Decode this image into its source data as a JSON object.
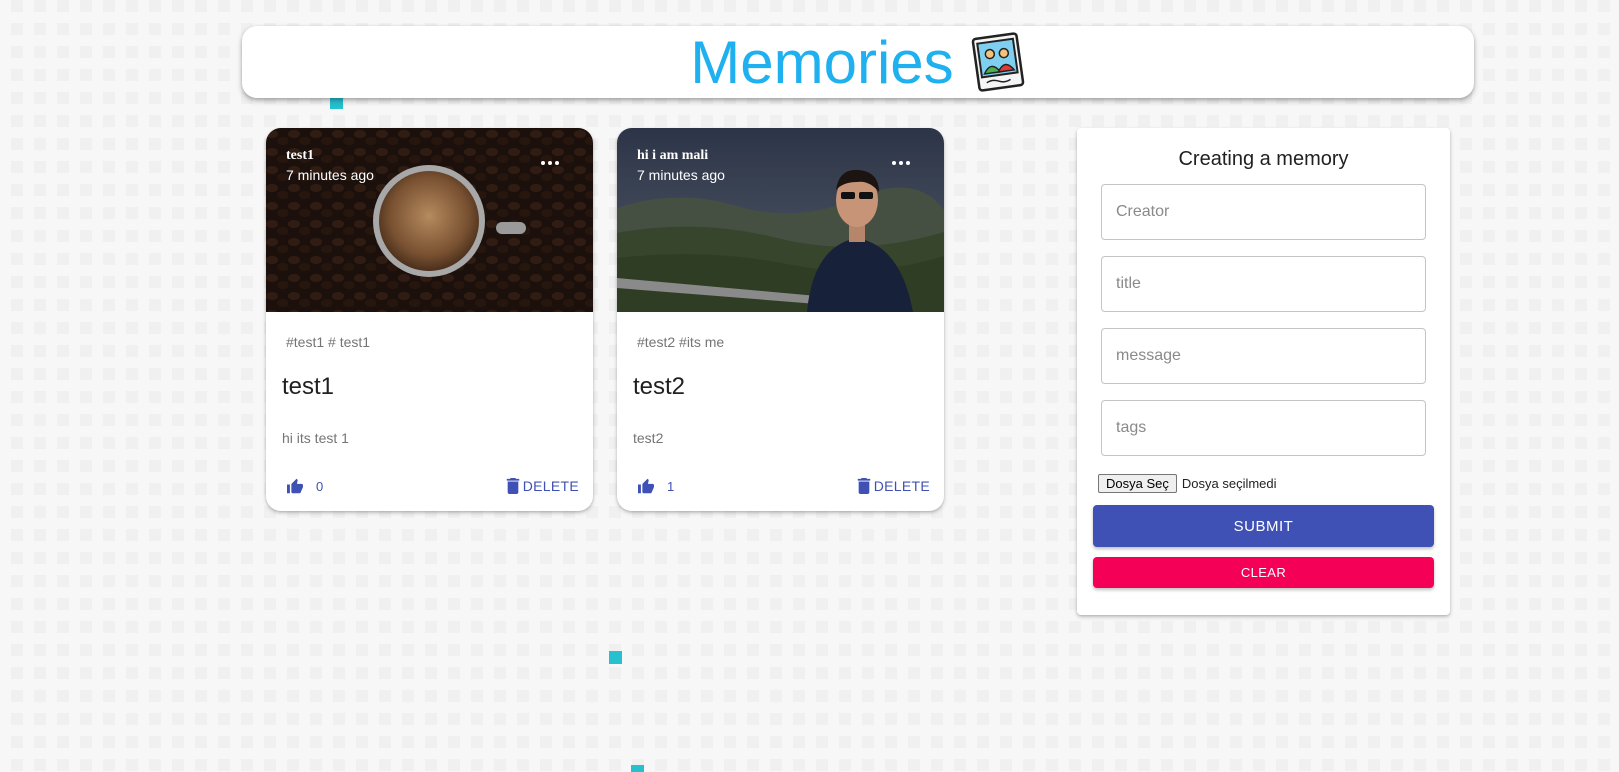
{
  "header": {
    "title": "Memories"
  },
  "posts": [
    {
      "creator": "test1",
      "time": "7 minutes ago",
      "tags": "#test1 # test1",
      "title": "test1",
      "message": "hi its test 1",
      "like_count": "0",
      "delete_label": "DELETE"
    },
    {
      "creator": "hi i am mali",
      "time": "7 minutes ago",
      "tags": "#test2 #its me",
      "title": "test2",
      "message": "test2",
      "like_count": "1",
      "delete_label": "DELETE"
    }
  ],
  "form": {
    "title": "Creating a memory",
    "creator_placeholder": "Creator",
    "title_placeholder": "title",
    "message_placeholder": "message",
    "tags_placeholder": "tags",
    "file_button_label": "Dosya Seç",
    "file_status": "Dosya seçilmedi",
    "submit_label": "SUBMIT",
    "clear_label": "CLEAR"
  },
  "colors": {
    "title_blue": "#1fb0f0",
    "primary": "#3f51b5",
    "secondary": "#f50057",
    "accent_square": "#26c0cf"
  },
  "icons": {
    "logo": "polaroid-memories-icon",
    "like": "thumb-up-icon",
    "delete": "trash-icon",
    "more": "more-horiz-icon"
  }
}
